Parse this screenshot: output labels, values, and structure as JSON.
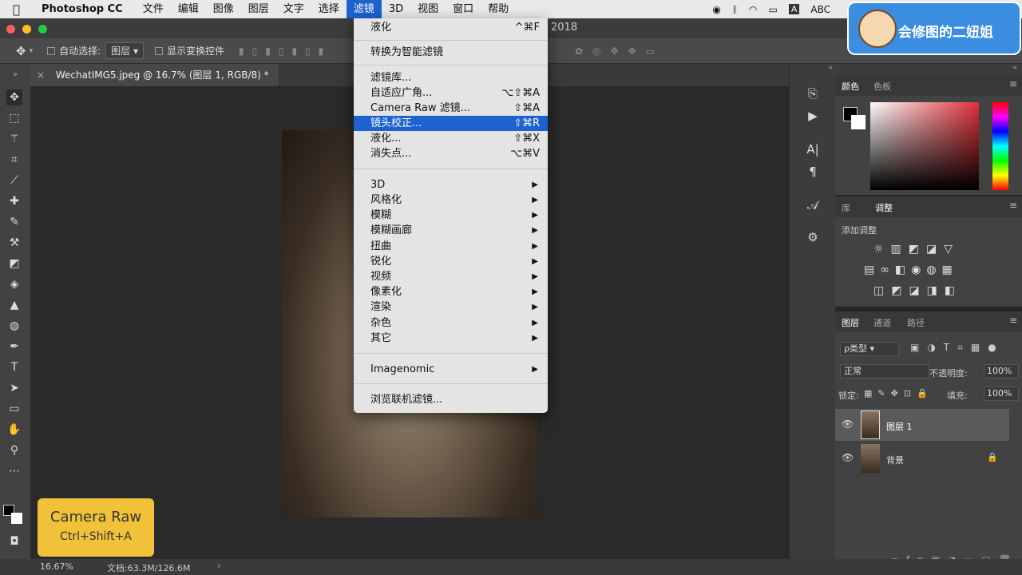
{
  "menubar": {
    "app": "Photoshop CC",
    "items": [
      "文件",
      "编辑",
      "图像",
      "图层",
      "文字",
      "选择",
      "滤镜",
      "3D",
      "视图",
      "窗口",
      "帮助"
    ],
    "active_index": 6,
    "input_source": "ABC"
  },
  "window": {
    "title": "2018"
  },
  "options": {
    "auto_select_label": "自动选择:",
    "auto_select_value": "图层",
    "show_transform_label": "显示变换控件"
  },
  "document_tab": {
    "close": "×",
    "label": "WechatIMG5.jpeg @ 16.7% (图层 1, RGB/8) *"
  },
  "filter_menu": {
    "items": [
      {
        "label": "液化",
        "shortcut": "^⌘F"
      },
      {
        "label": "转换为智能滤镜",
        "shortcut": ""
      },
      {
        "label": "滤镜库...",
        "shortcut": ""
      },
      {
        "label": "自适应广角...",
        "shortcut": "⌥⇧⌘A"
      },
      {
        "label": "Camera Raw 滤镜...",
        "shortcut": "⇧⌘A"
      },
      {
        "label": "镜头校正...",
        "shortcut": "⇧⌘R"
      },
      {
        "label": "液化...",
        "shortcut": "⇧⌘X"
      },
      {
        "label": "消失点...",
        "shortcut": "⌥⌘V"
      },
      {
        "label": "3D",
        "shortcut": ""
      },
      {
        "label": "风格化",
        "shortcut": ""
      },
      {
        "label": "模糊",
        "shortcut": ""
      },
      {
        "label": "模糊画廊",
        "shortcut": ""
      },
      {
        "label": "扭曲",
        "shortcut": ""
      },
      {
        "label": "锐化",
        "shortcut": ""
      },
      {
        "label": "视频",
        "shortcut": ""
      },
      {
        "label": "像素化",
        "shortcut": ""
      },
      {
        "label": "渲染",
        "shortcut": ""
      },
      {
        "label": "杂色",
        "shortcut": ""
      },
      {
        "label": "其它",
        "shortcut": ""
      },
      {
        "label": "Imagenomic",
        "shortcut": ""
      },
      {
        "label": "浏览联机滤镜...",
        "shortcut": ""
      }
    ],
    "highlighted_index": 5
  },
  "color_panel": {
    "tabs": [
      "颜色",
      "色板"
    ],
    "active": "颜色",
    "fg": "#000000",
    "bg": "#ffffff"
  },
  "adjust_panel": {
    "tabs": [
      "库",
      "调整"
    ],
    "active": "调整",
    "title": "添加调整"
  },
  "layers_panel": {
    "tabs": [
      "图层",
      "通道",
      "路径"
    ],
    "active": "图层",
    "filter_label": "ρ类型",
    "blend_mode": "正常",
    "opacity_label": "不透明度:",
    "opacity_value": "100%",
    "lock_label": "锁定:",
    "fill_label": "填充:",
    "fill_value": "100%",
    "layers": [
      {
        "name": "图层 1",
        "selected": true
      },
      {
        "name": "背景",
        "locked": true
      }
    ]
  },
  "status": {
    "zoom": "16.67%",
    "doc": "文档:63.3M/126.6M"
  },
  "overlay_camera_raw": {
    "title": "Camera Raw",
    "shortcut": "Ctrl+Shift+A"
  },
  "watermark": {
    "text": "会修图的二妞姐"
  }
}
